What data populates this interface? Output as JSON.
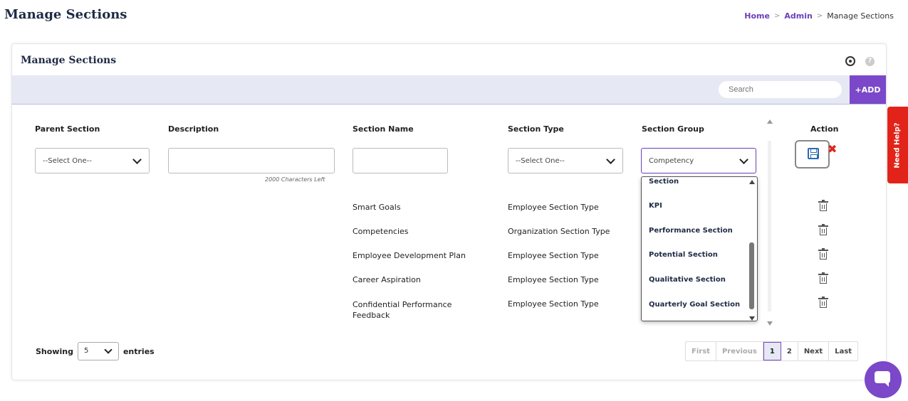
{
  "page": {
    "title": "Manage Sections",
    "breadcrumb": {
      "home": "Home",
      "admin": "Admin",
      "current": "Manage Sections",
      "sep": ">"
    }
  },
  "card": {
    "title": "Manage Sections",
    "help_icon": "?",
    "search_placeholder": "Search",
    "add_label": "+ADD"
  },
  "columns": {
    "parent_section": "Parent Section",
    "description": "Description",
    "section_name": "Section Name",
    "section_type": "Section Type",
    "section_group": "Section Group",
    "action": "Action"
  },
  "form": {
    "parent_section_value": "--Select One--",
    "description_value": "",
    "chars_left": "2000 Characters Left",
    "section_name_value": "",
    "section_type_value": "--Select One--",
    "section_group_value": "Competency"
  },
  "dropdown_options": [
    "Section",
    "KPI",
    "Performance Section",
    "Potential Section",
    "Qualitative Section",
    "Quarterly Goal Section"
  ],
  "rows": [
    {
      "name": "Smart Goals",
      "type": "Employee Section Type"
    },
    {
      "name": "Competencies",
      "type": "Organization Section Type"
    },
    {
      "name": "Employee Development Plan",
      "type": "Employee Section Type"
    },
    {
      "name": "Career Aspiration",
      "type": "Employee Section Type"
    },
    {
      "name": "Confidential Performance Feedback",
      "type": "Employee Section Type"
    }
  ],
  "footer": {
    "showing": "Showing",
    "entries_value": "5",
    "entries": "entries",
    "pager": {
      "first": "First",
      "previous": "Previous",
      "page1": "1",
      "page2": "2",
      "next": "Next",
      "last": "Last"
    }
  },
  "widgets": {
    "need_help": "Need Help?"
  },
  "icons": {
    "save": "save-icon",
    "cancel": "close-icon",
    "delete": "trash-icon",
    "settings": "settings-icon",
    "help": "help-icon",
    "chat": "chat-icon"
  },
  "colors": {
    "accent": "#7b48c9",
    "toolbar_bg": "#e6e8f4",
    "danger": "#e2231a",
    "save_blue": "#2e6ab0"
  }
}
